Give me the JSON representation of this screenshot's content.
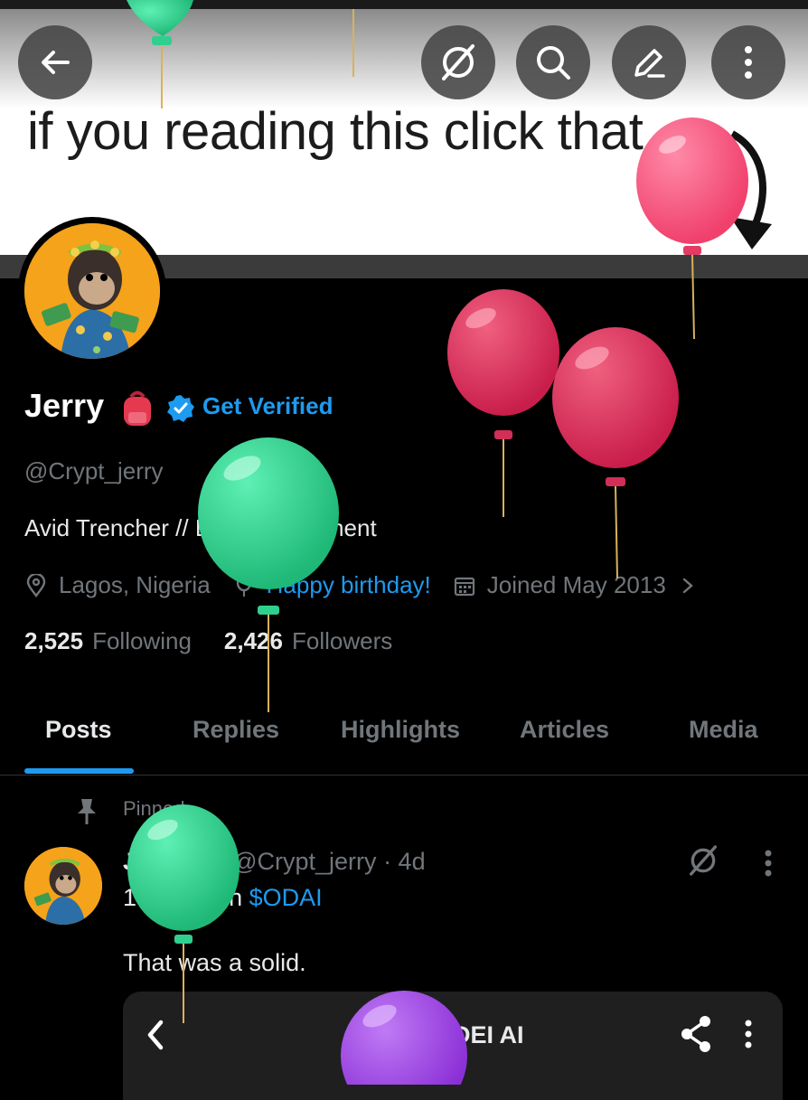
{
  "banner": {
    "text": "if you reading this click that"
  },
  "nav": {
    "back_icon": "arrow-left-icon",
    "grok_icon": "grok-icon",
    "search_icon": "search-icon",
    "edit_icon": "edit-icon",
    "more_icon": "more-vertical-icon"
  },
  "profile": {
    "name": "Jerry",
    "get_verified": "Get Verified",
    "handle": "@Crypt_jerry",
    "bio": "Avid Trencher // Defi // investment",
    "location": "Lagos, Nigeria",
    "birthday": "Happy birthday!",
    "joined": "Joined May 2013",
    "following_count": "2,525",
    "following_label": "Following",
    "followers_count": "2,426",
    "followers_label": "Followers"
  },
  "tabs": [
    "Posts",
    "Replies",
    "Highlights",
    "Articles",
    "Media"
  ],
  "post": {
    "pinned_label": "Pinned",
    "author": "Jerry",
    "handle": "@Crypt_jerry",
    "time": "· 4d",
    "text_prefix": "100x hit on ",
    "cashtag": "$ODAI",
    "text_line2": "That was a solid.",
    "card_title": "ODEI AI"
  },
  "colors": {
    "accent": "#1d9bf0",
    "background": "#000000",
    "muted": "#71767b",
    "balloon_green": "#2fcf8f",
    "balloon_red": "#d9335c",
    "balloon_pink": "#ff5a86",
    "balloon_purple": "#9a3fe0"
  }
}
